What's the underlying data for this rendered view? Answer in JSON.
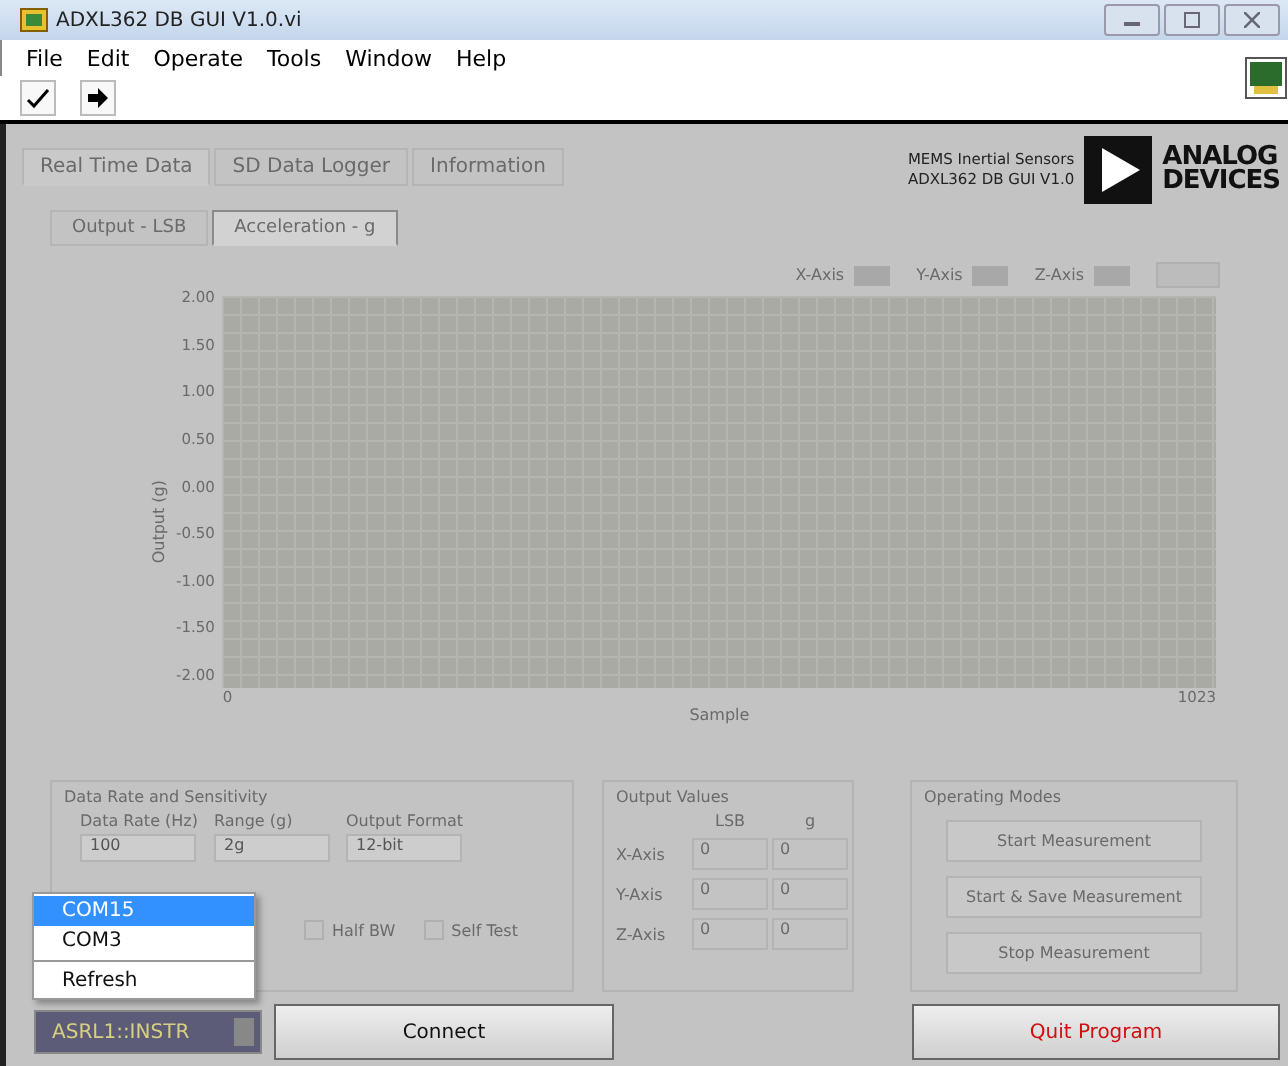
{
  "window": {
    "title": "ADXL362 DB GUI V1.0.vi"
  },
  "menu": [
    "File",
    "Edit",
    "Operate",
    "Tools",
    "Window",
    "Help"
  ],
  "brand": {
    "line1": "MEMS Inertial Sensors",
    "line2": "ADXL362 DB GUI V1.0",
    "logo_line1": "ANALOG",
    "logo_line2": "DEVICES"
  },
  "tabs": [
    {
      "label": "Real Time Data",
      "selected": true
    },
    {
      "label": "SD Data Logger",
      "selected": false
    },
    {
      "label": "Information",
      "selected": false
    }
  ],
  "subtabs": [
    {
      "label": "Output - LSB",
      "selected": false
    },
    {
      "label": "Acceleration - g",
      "selected": true
    }
  ],
  "legend": [
    {
      "label": "X-Axis",
      "color": "#a8a8a8"
    },
    {
      "label": "Y-Axis",
      "color": "#a8a8a8"
    },
    {
      "label": "Z-Axis",
      "color": "#a8a8a8"
    }
  ],
  "graph": {
    "y_label": "Output (g)",
    "y_ticks": [
      "2.00",
      "1.50",
      "1.00",
      "0.50",
      "0.00",
      "-0.50",
      "-1.00",
      "-1.50",
      "-2.00"
    ],
    "x_ticks": [
      "0",
      "1023"
    ],
    "x_label": "Sample"
  },
  "settings": {
    "title": "Data Rate and Sensitivity",
    "fields": [
      {
        "label": "Data Rate (Hz)",
        "value": "100"
      },
      {
        "label": "Range (g)",
        "value": "2g"
      },
      {
        "label": "Output Format",
        "value": "12-bit"
      }
    ],
    "checks": [
      {
        "label": "Half BW",
        "checked": false
      },
      {
        "label": "Self Test",
        "checked": false
      }
    ]
  },
  "output_values": {
    "title": "Output Values",
    "columns": [
      "LSB",
      "g"
    ],
    "rows": [
      {
        "label": "X-Axis",
        "values": [
          "0",
          "0"
        ]
      },
      {
        "label": "Y-Axis",
        "values": [
          "0",
          "0"
        ]
      },
      {
        "label": "Z-Axis",
        "values": [
          "0",
          "0"
        ]
      }
    ]
  },
  "modes": {
    "title": "Operating Modes",
    "buttons": [
      "Start Measurement",
      "Start & Save Measurement",
      "Stop Measurement"
    ]
  },
  "port_menu": [
    {
      "label": "COM15",
      "selected": true
    },
    {
      "label": "COM3",
      "selected": false
    },
    {
      "label": "Refresh",
      "selected": false
    }
  ],
  "port": {
    "value": "ASRL1::INSTR"
  },
  "buttons": {
    "connect": "Connect",
    "quit": "Quit Program"
  }
}
